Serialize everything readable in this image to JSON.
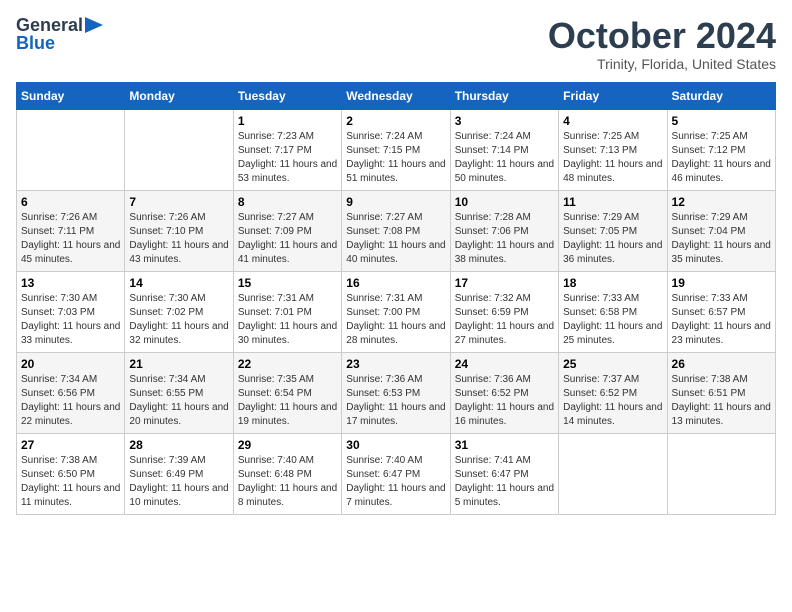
{
  "logo": {
    "line1": "General",
    "line2": "Blue"
  },
  "title": "October 2024",
  "location": "Trinity, Florida, United States",
  "headers": [
    "Sunday",
    "Monday",
    "Tuesday",
    "Wednesday",
    "Thursday",
    "Friday",
    "Saturday"
  ],
  "weeks": [
    [
      {
        "day": "",
        "info": ""
      },
      {
        "day": "",
        "info": ""
      },
      {
        "day": "1",
        "info": "Sunrise: 7:23 AM\nSunset: 7:17 PM\nDaylight: 11 hours and 53 minutes."
      },
      {
        "day": "2",
        "info": "Sunrise: 7:24 AM\nSunset: 7:15 PM\nDaylight: 11 hours and 51 minutes."
      },
      {
        "day": "3",
        "info": "Sunrise: 7:24 AM\nSunset: 7:14 PM\nDaylight: 11 hours and 50 minutes."
      },
      {
        "day": "4",
        "info": "Sunrise: 7:25 AM\nSunset: 7:13 PM\nDaylight: 11 hours and 48 minutes."
      },
      {
        "day": "5",
        "info": "Sunrise: 7:25 AM\nSunset: 7:12 PM\nDaylight: 11 hours and 46 minutes."
      }
    ],
    [
      {
        "day": "6",
        "info": "Sunrise: 7:26 AM\nSunset: 7:11 PM\nDaylight: 11 hours and 45 minutes."
      },
      {
        "day": "7",
        "info": "Sunrise: 7:26 AM\nSunset: 7:10 PM\nDaylight: 11 hours and 43 minutes."
      },
      {
        "day": "8",
        "info": "Sunrise: 7:27 AM\nSunset: 7:09 PM\nDaylight: 11 hours and 41 minutes."
      },
      {
        "day": "9",
        "info": "Sunrise: 7:27 AM\nSunset: 7:08 PM\nDaylight: 11 hours and 40 minutes."
      },
      {
        "day": "10",
        "info": "Sunrise: 7:28 AM\nSunset: 7:06 PM\nDaylight: 11 hours and 38 minutes."
      },
      {
        "day": "11",
        "info": "Sunrise: 7:29 AM\nSunset: 7:05 PM\nDaylight: 11 hours and 36 minutes."
      },
      {
        "day": "12",
        "info": "Sunrise: 7:29 AM\nSunset: 7:04 PM\nDaylight: 11 hours and 35 minutes."
      }
    ],
    [
      {
        "day": "13",
        "info": "Sunrise: 7:30 AM\nSunset: 7:03 PM\nDaylight: 11 hours and 33 minutes."
      },
      {
        "day": "14",
        "info": "Sunrise: 7:30 AM\nSunset: 7:02 PM\nDaylight: 11 hours and 32 minutes."
      },
      {
        "day": "15",
        "info": "Sunrise: 7:31 AM\nSunset: 7:01 PM\nDaylight: 11 hours and 30 minutes."
      },
      {
        "day": "16",
        "info": "Sunrise: 7:31 AM\nSunset: 7:00 PM\nDaylight: 11 hours and 28 minutes."
      },
      {
        "day": "17",
        "info": "Sunrise: 7:32 AM\nSunset: 6:59 PM\nDaylight: 11 hours and 27 minutes."
      },
      {
        "day": "18",
        "info": "Sunrise: 7:33 AM\nSunset: 6:58 PM\nDaylight: 11 hours and 25 minutes."
      },
      {
        "day": "19",
        "info": "Sunrise: 7:33 AM\nSunset: 6:57 PM\nDaylight: 11 hours and 23 minutes."
      }
    ],
    [
      {
        "day": "20",
        "info": "Sunrise: 7:34 AM\nSunset: 6:56 PM\nDaylight: 11 hours and 22 minutes."
      },
      {
        "day": "21",
        "info": "Sunrise: 7:34 AM\nSunset: 6:55 PM\nDaylight: 11 hours and 20 minutes."
      },
      {
        "day": "22",
        "info": "Sunrise: 7:35 AM\nSunset: 6:54 PM\nDaylight: 11 hours and 19 minutes."
      },
      {
        "day": "23",
        "info": "Sunrise: 7:36 AM\nSunset: 6:53 PM\nDaylight: 11 hours and 17 minutes."
      },
      {
        "day": "24",
        "info": "Sunrise: 7:36 AM\nSunset: 6:52 PM\nDaylight: 11 hours and 16 minutes."
      },
      {
        "day": "25",
        "info": "Sunrise: 7:37 AM\nSunset: 6:52 PM\nDaylight: 11 hours and 14 minutes."
      },
      {
        "day": "26",
        "info": "Sunrise: 7:38 AM\nSunset: 6:51 PM\nDaylight: 11 hours and 13 minutes."
      }
    ],
    [
      {
        "day": "27",
        "info": "Sunrise: 7:38 AM\nSunset: 6:50 PM\nDaylight: 11 hours and 11 minutes."
      },
      {
        "day": "28",
        "info": "Sunrise: 7:39 AM\nSunset: 6:49 PM\nDaylight: 11 hours and 10 minutes."
      },
      {
        "day": "29",
        "info": "Sunrise: 7:40 AM\nSunset: 6:48 PM\nDaylight: 11 hours and 8 minutes."
      },
      {
        "day": "30",
        "info": "Sunrise: 7:40 AM\nSunset: 6:47 PM\nDaylight: 11 hours and 7 minutes."
      },
      {
        "day": "31",
        "info": "Sunrise: 7:41 AM\nSunset: 6:47 PM\nDaylight: 11 hours and 5 minutes."
      },
      {
        "day": "",
        "info": ""
      },
      {
        "day": "",
        "info": ""
      }
    ]
  ]
}
